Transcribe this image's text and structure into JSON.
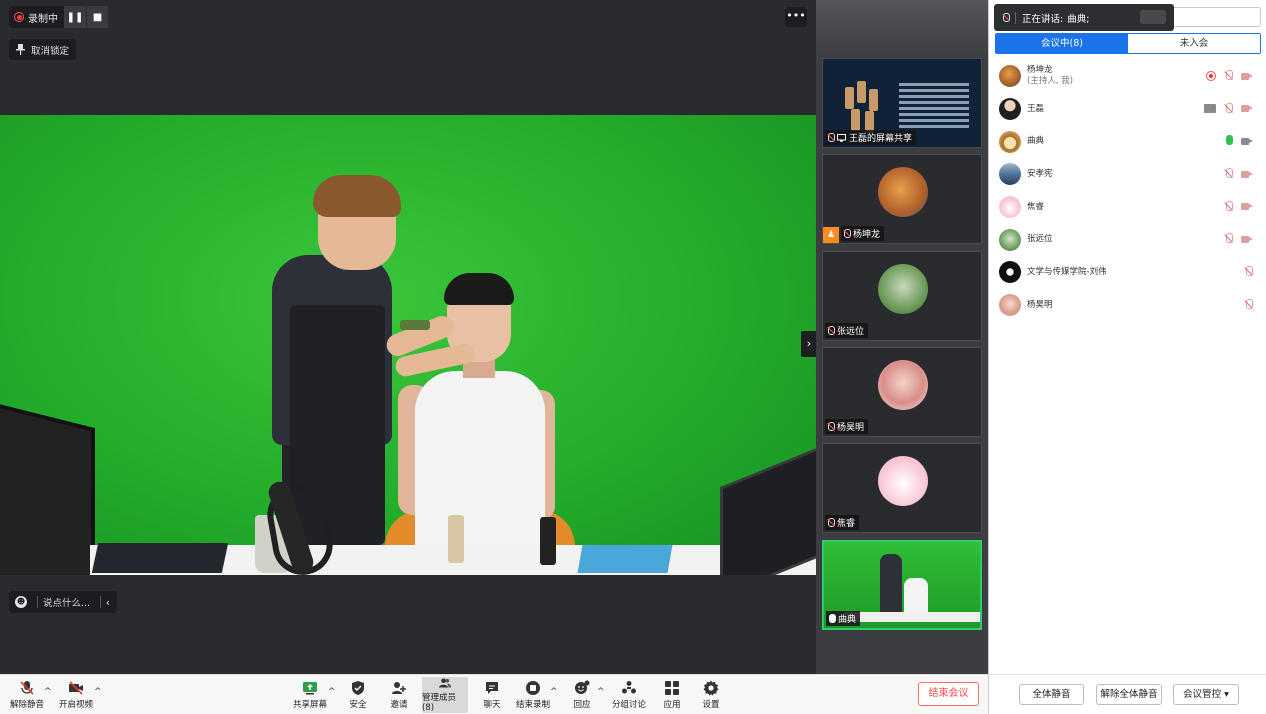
{
  "recording": {
    "status_label": "录制中",
    "pause_glyph": "❚❚",
    "stop_glyph": "■"
  },
  "main": {
    "unlock_label": "取消锁定",
    "more_glyph": "•••",
    "chat_placeholder": "说点什么...",
    "chat_emoji": "☻",
    "chat_collapse": "‹",
    "side_arrow": "›"
  },
  "thumbnails": [
    {
      "name": "王磊的屏幕共享",
      "type": "screen-share",
      "mic": "muted"
    },
    {
      "name": "杨坤龙",
      "type": "avatar",
      "host": true,
      "mic": "muted",
      "avatar_color": "#c8823c"
    },
    {
      "name": "张远位",
      "type": "avatar",
      "mic": "muted",
      "avatar_color": "#7fae6a"
    },
    {
      "name": "杨昊明",
      "type": "avatar",
      "mic": "muted",
      "avatar_color": "#e9c0b0"
    },
    {
      "name": "焦睿",
      "type": "avatar",
      "mic": "muted",
      "avatar_color": "#f4b8c8"
    },
    {
      "name": "曲典",
      "type": "video",
      "mic": "on",
      "active": true
    }
  ],
  "panel": {
    "speaking_prefix": "正在讲话:",
    "speaking_name": "曲典;",
    "tab_in_meeting": "会议中(8)",
    "tab_not_joined": "未入会",
    "participants": [
      {
        "name": "杨坤龙",
        "sub": "(主持人, 我)",
        "avatar_color": "#b07a3e",
        "icons": [
          "rec",
          "mic-muted",
          "cam-off"
        ]
      },
      {
        "name": "王磊",
        "sub": "",
        "avatar_color": "#2b2b2b",
        "icons": [
          "share",
          "mic-muted",
          "cam-off"
        ]
      },
      {
        "name": "曲典",
        "sub": "",
        "avatar_color": "#e8c27a",
        "icons": [
          "mic-on",
          "cam-gray"
        ]
      },
      {
        "name": "安孝宪",
        "sub": "",
        "avatar_color": "#4a6e94",
        "icons": [
          "mic-muted",
          "cam-off"
        ]
      },
      {
        "name": "焦睿",
        "sub": "",
        "avatar_color": "#f3b6c6",
        "icons": [
          "mic-muted",
          "cam-off"
        ]
      },
      {
        "name": "张远位",
        "sub": "",
        "avatar_color": "#6ea060",
        "icons": [
          "mic-muted",
          "cam-off"
        ]
      },
      {
        "name": "文学与传媒学院-刘伟",
        "sub": "",
        "avatar_color": "#1a1a1a",
        "icons": [
          "mic-muted"
        ]
      },
      {
        "name": "杨昊明",
        "sub": "",
        "avatar_color": "#e4b8a8",
        "icons": [
          "mic-muted"
        ]
      }
    ],
    "mute_all": "全体静音",
    "unmute_all": "解除全体静音",
    "meeting_control": "会议管控 ▾"
  },
  "toolbar": {
    "unmute": "解除静音",
    "start_video": "开启视频",
    "share_screen": "共享屏幕",
    "security": "安全",
    "invite": "邀请",
    "manage_members": "管理成员(8)",
    "chat": "聊天",
    "end_recording": "结束录制",
    "reactions": "回应",
    "breakout": "分组讨论",
    "apps": "应用",
    "settings": "设置",
    "end_meeting": "结束会议",
    "caret": "^"
  }
}
